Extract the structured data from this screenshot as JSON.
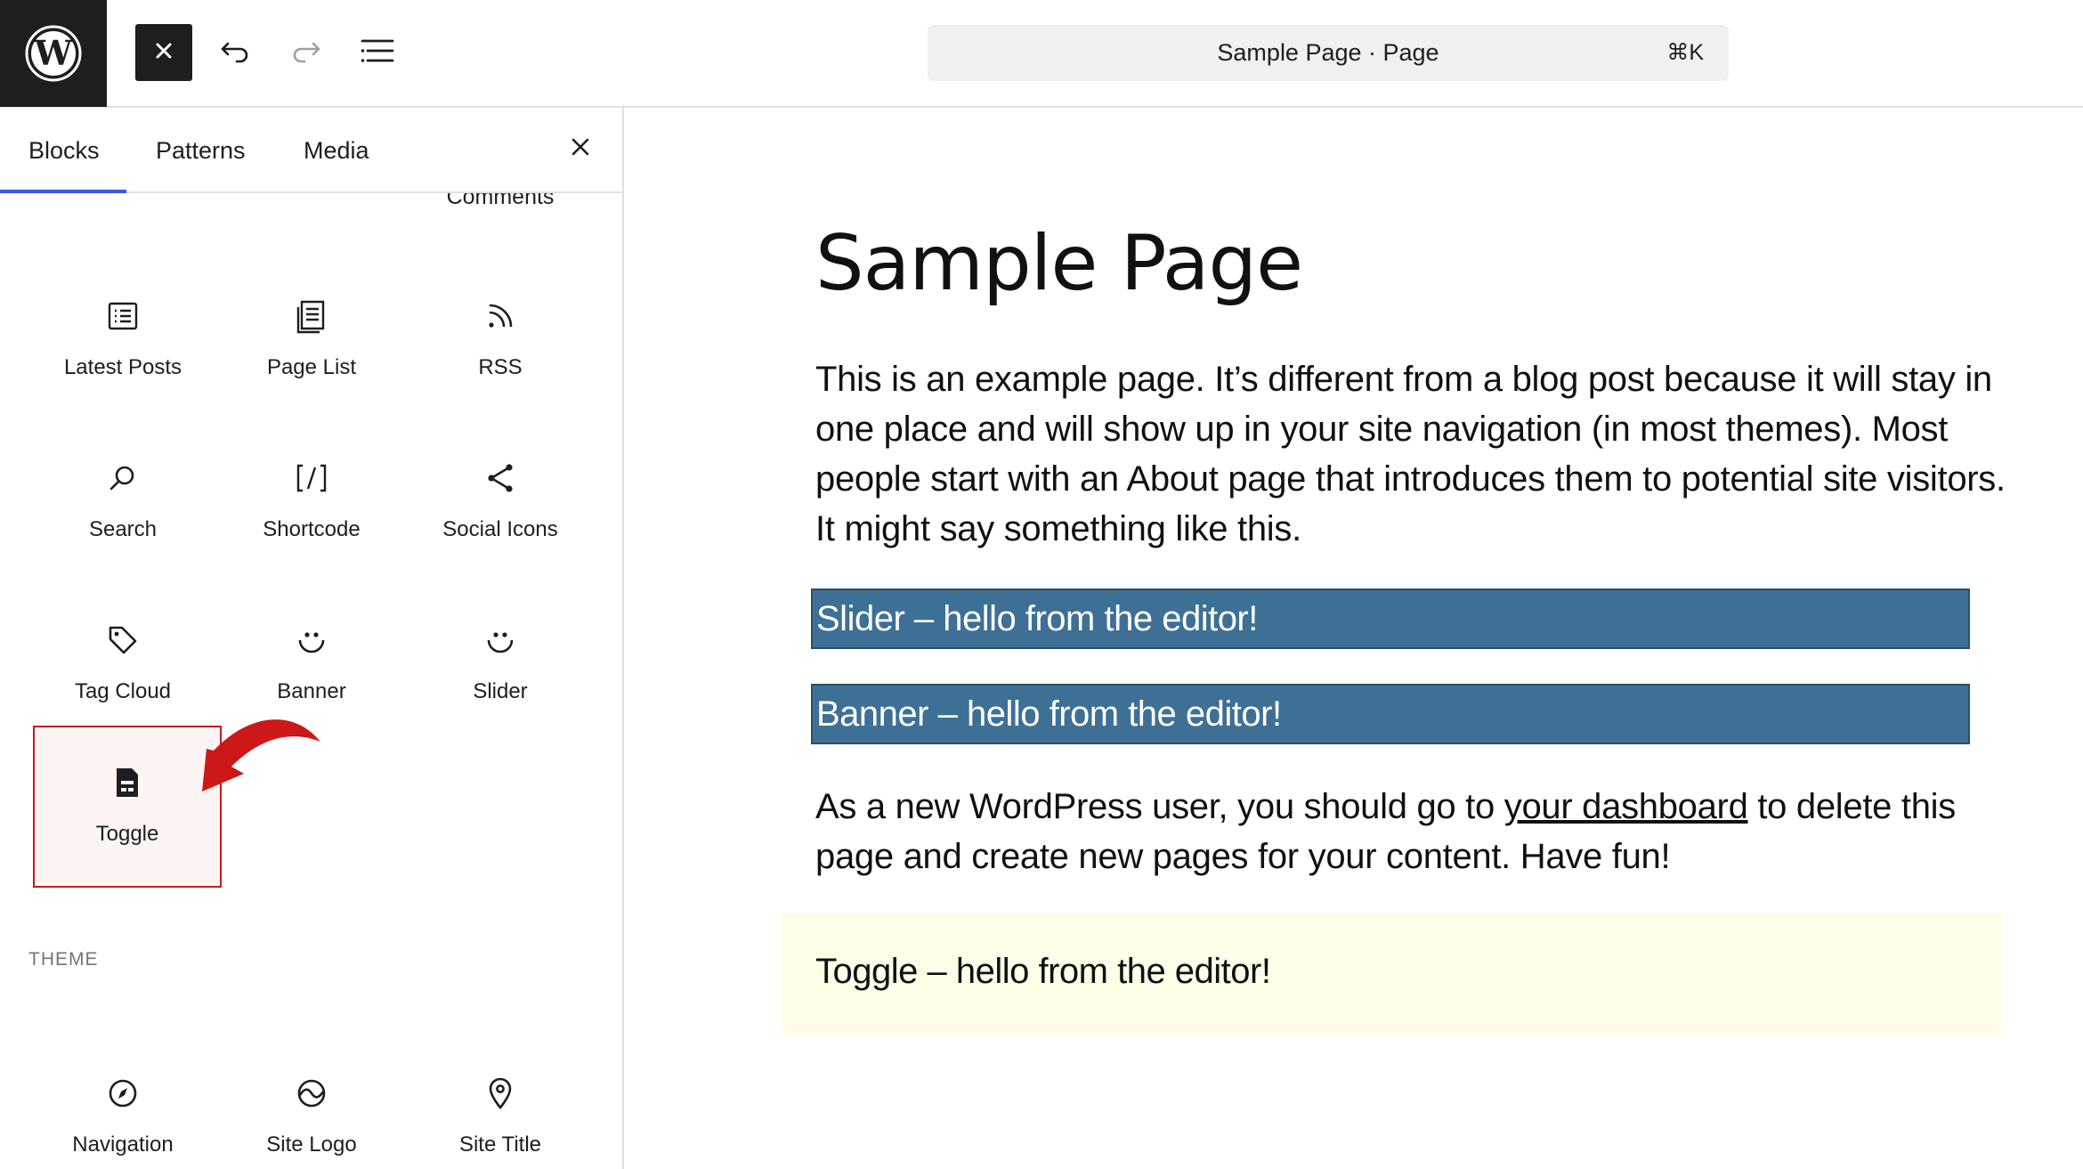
{
  "colors": {
    "accent": "#3858e9",
    "dark": "#1e1e1e",
    "custom_block_bg": "#3e7096",
    "toggle_bg": "#fefee8",
    "highlight_border": "#cc1818",
    "arrow": "#cc1818"
  },
  "toolbar": {
    "logo_icon": "wordpress-logo-icon",
    "inserter_icon": "close-icon",
    "undo_icon": "undo-icon",
    "redo_icon": "redo-icon",
    "outline_icon": "document-overview-icon"
  },
  "command_bar": {
    "title": "Sample Page · Page",
    "shortcut": "⌘K"
  },
  "inserter": {
    "tabs": [
      {
        "label": "Blocks",
        "active": true
      },
      {
        "label": "Patterns",
        "active": false
      },
      {
        "label": "Media",
        "active": false
      }
    ],
    "cut_off_label": "Comments",
    "blocks": [
      {
        "label": "Latest Posts",
        "icon": "latest-posts-icon"
      },
      {
        "label": "Page List",
        "icon": "page-list-icon"
      },
      {
        "label": "RSS",
        "icon": "rss-icon"
      },
      {
        "label": "Search",
        "icon": "search-icon"
      },
      {
        "label": "Shortcode",
        "icon": "shortcode-icon"
      },
      {
        "label": "Social Icons",
        "icon": "share-icon"
      },
      {
        "label": "Tag Cloud",
        "icon": "tag-icon"
      },
      {
        "label": "Banner",
        "icon": "smiley-icon"
      },
      {
        "label": "Slider",
        "icon": "smiley-icon"
      },
      {
        "label": "Toggle",
        "icon": "form-icon",
        "highlighted": true
      }
    ],
    "theme_section": {
      "label": "THEME",
      "blocks": [
        {
          "label": "Navigation",
          "icon": "compass-icon"
        },
        {
          "label": "Site Logo",
          "icon": "site-logo-icon"
        },
        {
          "label": "Site Title",
          "icon": "map-marker-icon"
        }
      ]
    }
  },
  "editor": {
    "title": "Sample Page",
    "paragraph1": "This is an example page. It’s different from a blog post because it will stay in one place and will show up in your site navigation (in most themes). Most people start with an About page that introduces them to potential site visitors. It might say something like this.",
    "slider_block": "Slider – hello from the editor!",
    "banner_block": "Banner – hello from the editor!",
    "paragraph2_before": "As a new WordPress user, you should go to ",
    "paragraph2_link": "your dashboard",
    "paragraph2_after": " to delete this page and create new pages for your content. Have fun!",
    "toggle_block": "Toggle – hello from the editor!"
  }
}
